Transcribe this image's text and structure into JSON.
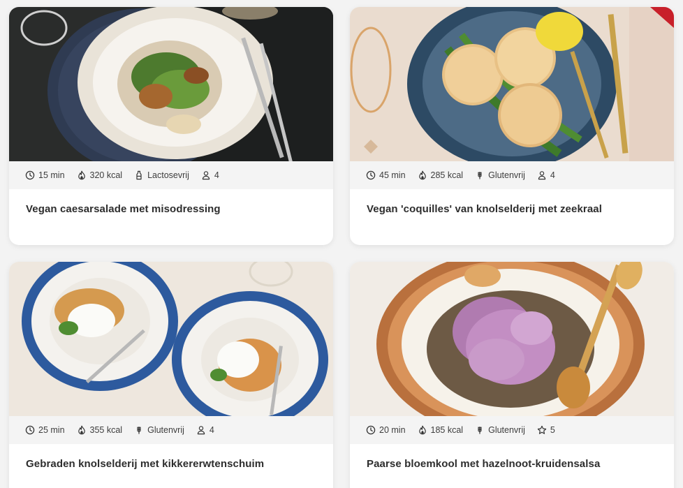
{
  "recipes": [
    {
      "title": "Vegan caesarsalade met misodressing",
      "time": "15 min",
      "kcal": "320 kcal",
      "diet": "Lactosevrij",
      "diet_icon": "bottle-icon",
      "extra_value": "4",
      "extra_icon": "person-icon"
    },
    {
      "title": "Vegan 'coquilles' van knolselderij met zeekraal",
      "time": "45 min",
      "kcal": "285 kcal",
      "diet": "Glutenvrij",
      "diet_icon": "wheat-icon",
      "extra_value": "4",
      "extra_icon": "person-icon"
    },
    {
      "title": "Gebraden knolselderij met kikkererwtenschuim",
      "time": "25 min",
      "kcal": "355 kcal",
      "diet": "Glutenvrij",
      "diet_icon": "wheat-icon",
      "extra_value": "4",
      "extra_icon": "person-icon"
    },
    {
      "title": "Paarse bloemkool met hazelnoot-kruidensalsa",
      "time": "20 min",
      "kcal": "185 kcal",
      "diet": "Glutenvrij",
      "diet_icon": "wheat-icon",
      "extra_value": "5",
      "extra_icon": "star-icon"
    }
  ],
  "colors": {
    "card_background": "#ffffff",
    "meta_bar": "#f4f4f4",
    "page_background": "#f3f3f3",
    "title_text": "#2d2d2d"
  }
}
